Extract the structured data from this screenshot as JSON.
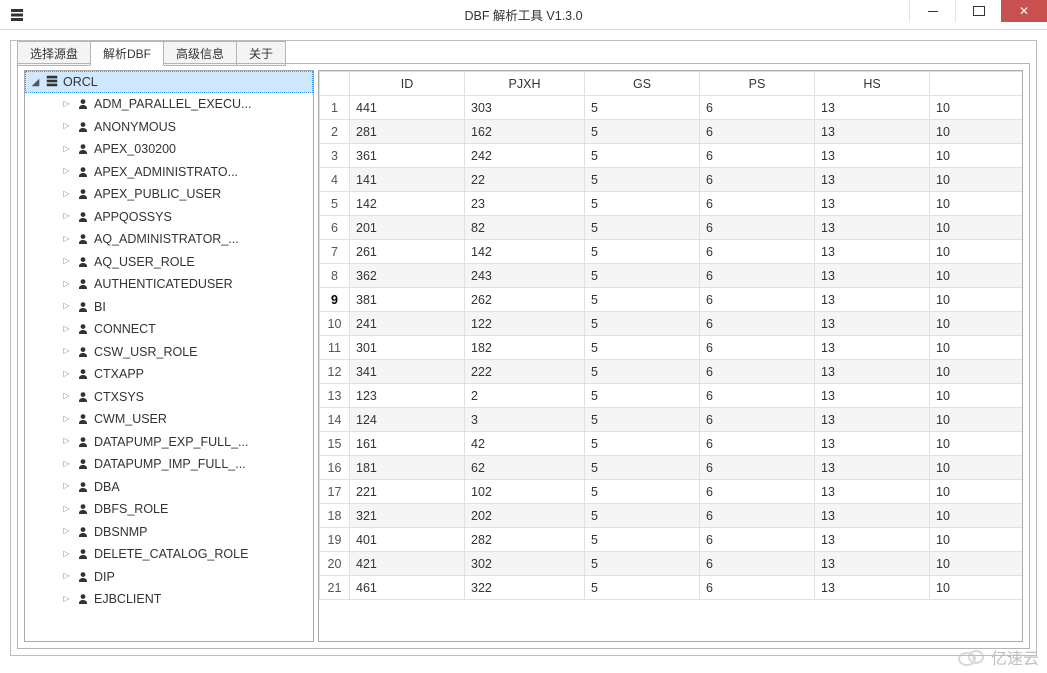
{
  "window": {
    "title": "DBF 解析工具  V1.3.0"
  },
  "tabs": [
    {
      "label": "选择源盘"
    },
    {
      "label": "解析DBF"
    },
    {
      "label": "高级信息"
    },
    {
      "label": "关于"
    }
  ],
  "active_tab": 1,
  "tree": {
    "root_label": "ORCL",
    "items": [
      "ADM_PARALLEL_EXECU...",
      "ANONYMOUS",
      "APEX_030200",
      "APEX_ADMINISTRATO...",
      "APEX_PUBLIC_USER",
      "APPQOSSYS",
      "AQ_ADMINISTRATOR_...",
      "AQ_USER_ROLE",
      "AUTHENTICATEDUSER",
      "BI",
      "CONNECT",
      "CSW_USR_ROLE",
      "CTXAPP",
      "CTXSYS",
      "CWM_USER",
      "DATAPUMP_EXP_FULL_...",
      "DATAPUMP_IMP_FULL_...",
      "DBA",
      "DBFS_ROLE",
      "DBSNMP",
      "DELETE_CATALOG_ROLE",
      "DIP",
      "EJBCLIENT"
    ]
  },
  "grid": {
    "columns": [
      "ID",
      "PJXH",
      "GS",
      "PS",
      "HS",
      ""
    ],
    "selected_row_index": 8,
    "rows": [
      {
        "n": 1,
        "ID": "441",
        "PJXH": "303",
        "GS": "5",
        "PS": "6",
        "HS": "13",
        "X": "10"
      },
      {
        "n": 2,
        "ID": "281",
        "PJXH": "162",
        "GS": "5",
        "PS": "6",
        "HS": "13",
        "X": "10"
      },
      {
        "n": 3,
        "ID": "361",
        "PJXH": "242",
        "GS": "5",
        "PS": "6",
        "HS": "13",
        "X": "10"
      },
      {
        "n": 4,
        "ID": "141",
        "PJXH": "22",
        "GS": "5",
        "PS": "6",
        "HS": "13",
        "X": "10"
      },
      {
        "n": 5,
        "ID": "142",
        "PJXH": "23",
        "GS": "5",
        "PS": "6",
        "HS": "13",
        "X": "10"
      },
      {
        "n": 6,
        "ID": "201",
        "PJXH": "82",
        "GS": "5",
        "PS": "6",
        "HS": "13",
        "X": "10"
      },
      {
        "n": 7,
        "ID": "261",
        "PJXH": "142",
        "GS": "5",
        "PS": "6",
        "HS": "13",
        "X": "10"
      },
      {
        "n": 8,
        "ID": "362",
        "PJXH": "243",
        "GS": "5",
        "PS": "6",
        "HS": "13",
        "X": "10"
      },
      {
        "n": 9,
        "ID": "381",
        "PJXH": "262",
        "GS": "5",
        "PS": "6",
        "HS": "13",
        "X": "10"
      },
      {
        "n": 10,
        "ID": "241",
        "PJXH": "122",
        "GS": "5",
        "PS": "6",
        "HS": "13",
        "X": "10"
      },
      {
        "n": 11,
        "ID": "301",
        "PJXH": "182",
        "GS": "5",
        "PS": "6",
        "HS": "13",
        "X": "10"
      },
      {
        "n": 12,
        "ID": "341",
        "PJXH": "222",
        "GS": "5",
        "PS": "6",
        "HS": "13",
        "X": "10"
      },
      {
        "n": 13,
        "ID": "123",
        "PJXH": "2",
        "GS": "5",
        "PS": "6",
        "HS": "13",
        "X": "10"
      },
      {
        "n": 14,
        "ID": "124",
        "PJXH": "3",
        "GS": "5",
        "PS": "6",
        "HS": "13",
        "X": "10"
      },
      {
        "n": 15,
        "ID": "161",
        "PJXH": "42",
        "GS": "5",
        "PS": "6",
        "HS": "13",
        "X": "10"
      },
      {
        "n": 16,
        "ID": "181",
        "PJXH": "62",
        "GS": "5",
        "PS": "6",
        "HS": "13",
        "X": "10"
      },
      {
        "n": 17,
        "ID": "221",
        "PJXH": "102",
        "GS": "5",
        "PS": "6",
        "HS": "13",
        "X": "10"
      },
      {
        "n": 18,
        "ID": "321",
        "PJXH": "202",
        "GS": "5",
        "PS": "6",
        "HS": "13",
        "X": "10"
      },
      {
        "n": 19,
        "ID": "401",
        "PJXH": "282",
        "GS": "5",
        "PS": "6",
        "HS": "13",
        "X": "10"
      },
      {
        "n": 20,
        "ID": "421",
        "PJXH": "302",
        "GS": "5",
        "PS": "6",
        "HS": "13",
        "X": "10"
      },
      {
        "n": 21,
        "ID": "461",
        "PJXH": "322",
        "GS": "5",
        "PS": "6",
        "HS": "13",
        "X": "10"
      }
    ]
  },
  "watermark": "亿速云"
}
